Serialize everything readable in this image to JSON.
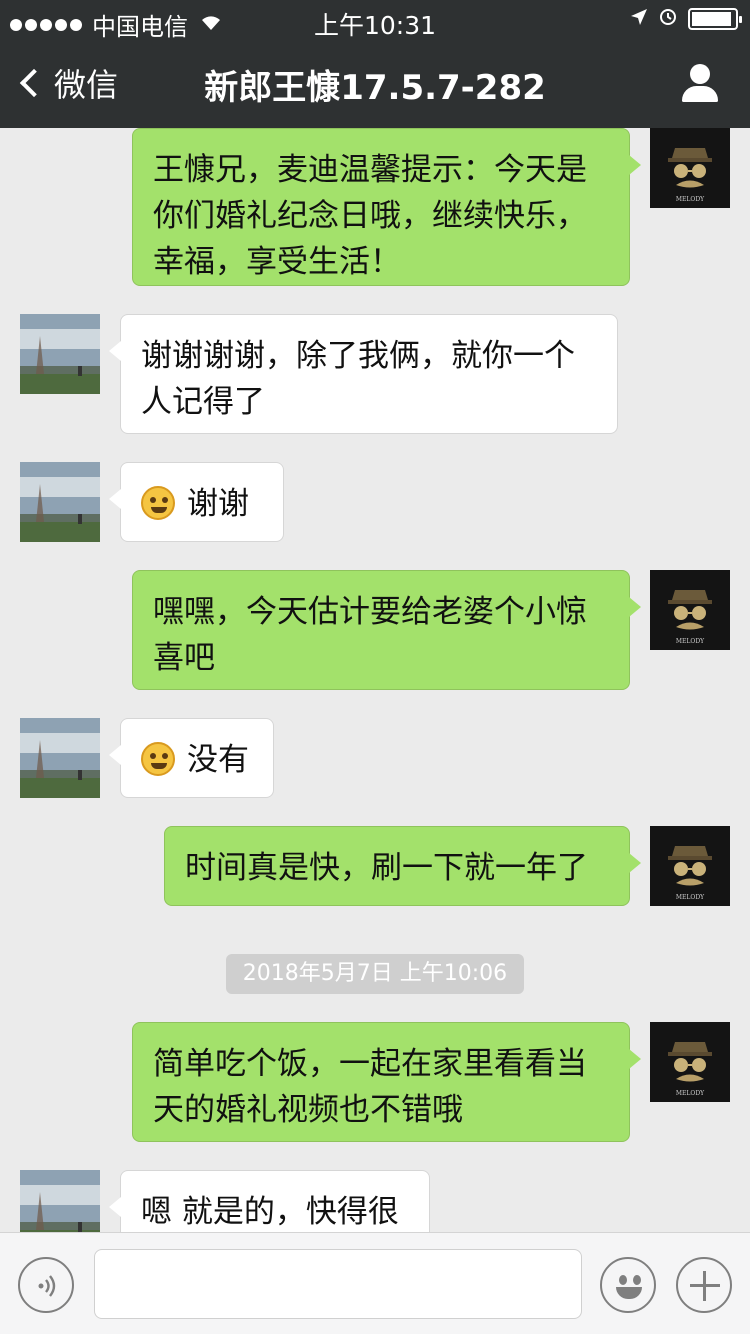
{
  "status_bar": {
    "carrier": "中国电信",
    "time": "上午10:31",
    "signal_bars": 5,
    "battery_level": 0.92
  },
  "nav": {
    "back_label": "微信",
    "title": "新郎王慷17.5.7-282"
  },
  "messages": [
    {
      "sender": "me",
      "text": "王慷兄，麦迪温馨提示：今天是\n你们婚礼纪念日哦，继续快乐，\n幸福，享受生活！"
    },
    {
      "sender": "other",
      "text": "谢谢谢谢，除了我俩，就你一个\n人记得了"
    },
    {
      "sender": "other",
      "emoji": "grinning-emoji",
      "text": "谢谢"
    },
    {
      "sender": "me",
      "text": "嘿嘿，今天估计要给老婆个小惊\n喜吧"
    },
    {
      "sender": "other",
      "emoji": "awkward-emoji",
      "text": "没有"
    },
    {
      "sender": "me",
      "text": "时间真是快，刷一下就一年了"
    },
    {
      "sender": "me",
      "text": "简单吃个饭，一起在家里看看当\n天的婚礼视频也不错哦"
    },
    {
      "sender": "other",
      "text": "嗯 就是的，快得很"
    }
  ],
  "timestamp": "2018年5月7日 上午10:06",
  "avatar_me_text": "MELODY",
  "input_bar": {
    "input_value": "",
    "voice_icon": "voice-icon",
    "emoji_icon": "emoji-icon",
    "plus_icon": "plus-icon"
  },
  "colors": {
    "nav_bg": "#2e3132",
    "chat_bg": "#ebebeb",
    "my_bubble": "#a3e16b",
    "their_bubble": "#ffffff"
  }
}
